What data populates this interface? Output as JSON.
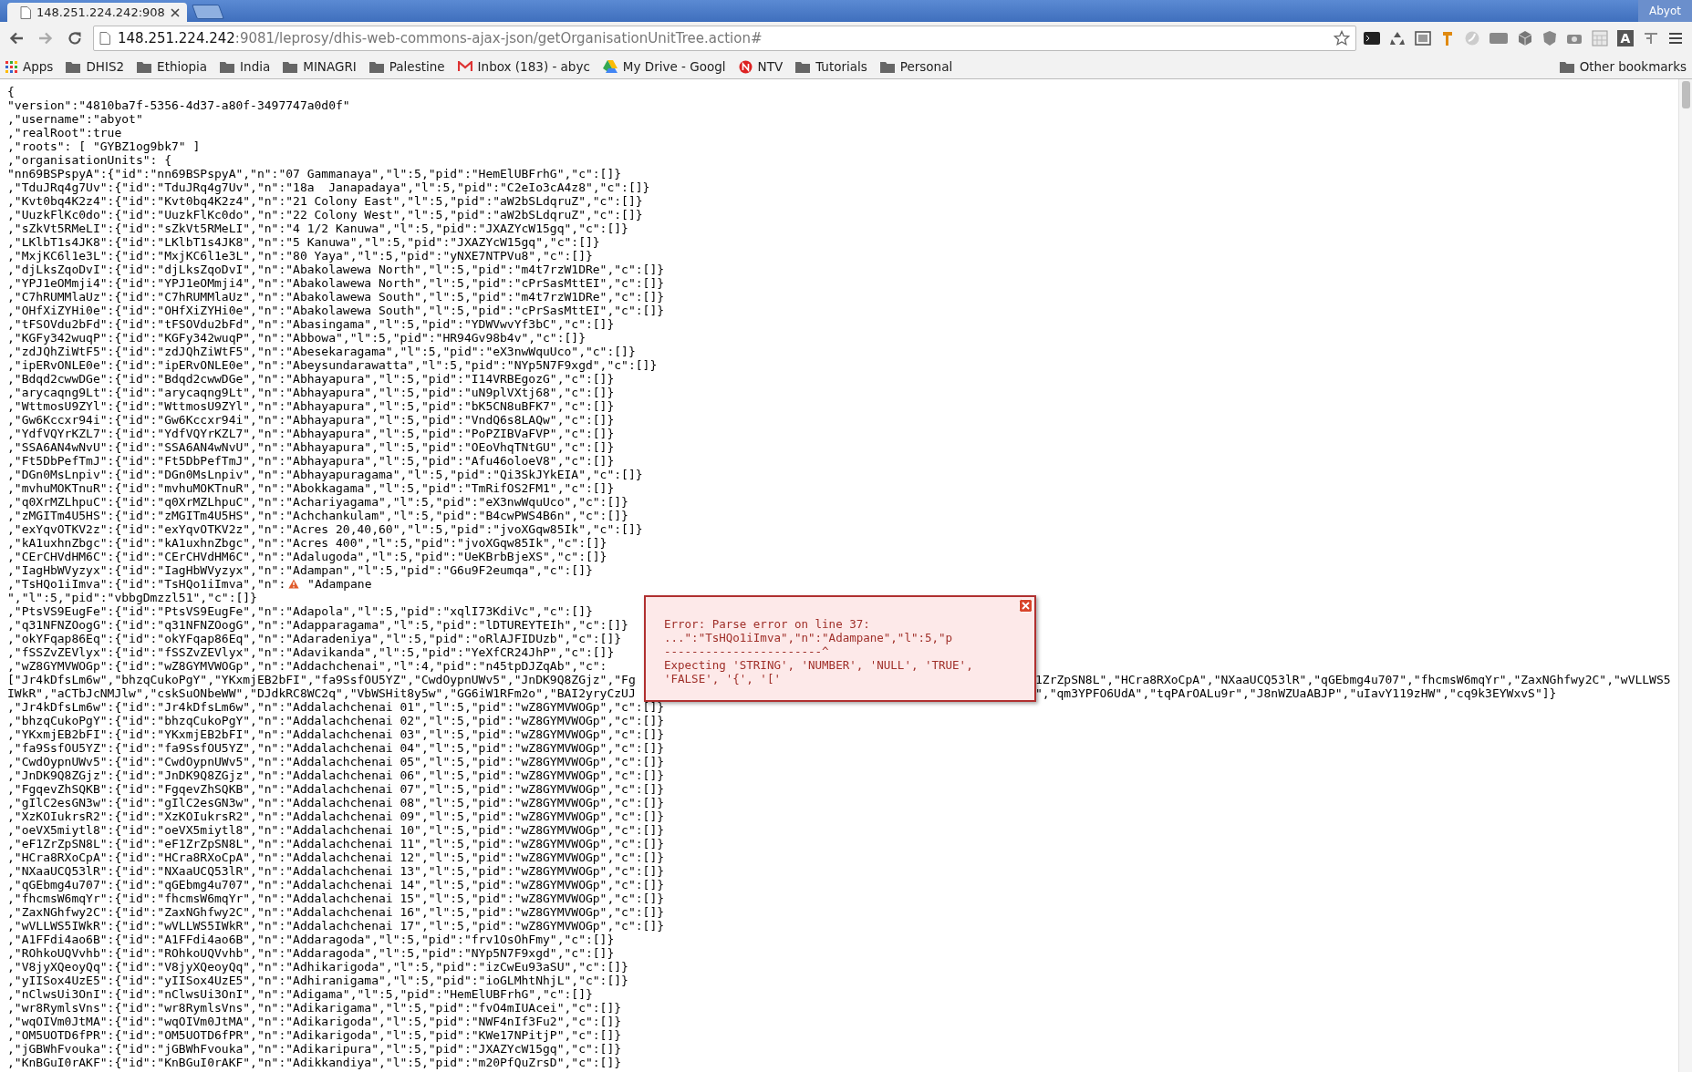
{
  "tab": {
    "title": "148.251.224.242:908",
    "selected": true
  },
  "user": "Abyot",
  "address": {
    "host": "148.251.224.242",
    "path": ":9081/leprosy/dhis-web-commons-ajax-json/getOrganisationUnitTree.action#"
  },
  "extension_label": "A",
  "bookmarks": [
    {
      "kind": "apps",
      "label": "Apps"
    },
    {
      "kind": "folder",
      "label": "DHIS2"
    },
    {
      "kind": "folder",
      "label": "Ethiopia"
    },
    {
      "kind": "folder",
      "label": "India"
    },
    {
      "kind": "folder",
      "label": "MINAGRI"
    },
    {
      "kind": "folder",
      "label": "Palestine"
    },
    {
      "kind": "mail",
      "label": "Inbox (183) - abyc"
    },
    {
      "kind": "drive",
      "label": "My Drive - Googl"
    },
    {
      "kind": "news",
      "label": "NTV"
    },
    {
      "kind": "folder",
      "label": "Tutorials"
    },
    {
      "kind": "folder",
      "label": "Personal"
    }
  ],
  "other_bookmarks": "Other bookmarks",
  "lines": [
    {
      "kind": "plain",
      "text": "{"
    },
    {
      "kind": "plain",
      "text": "\"version\":\"4810ba7f-5356-4d37-a80f-3497747a0d0f\""
    },
    {
      "kind": "plain",
      "text": ",\"username\":\"abyot\""
    },
    {
      "kind": "plain",
      "text": ",\"realRoot\":true"
    },
    {
      "kind": "plain",
      "text": ",\"roots\": [ \"GYBZ1og9bk7\" ]"
    },
    {
      "kind": "plain",
      "text": ",\"organisationUnits\": {"
    },
    {
      "kind": "plain",
      "text": "\"nn69BSPspyA\":{\"id\":\"nn69BSPspyA\",\"n\":\"07 Gammanaya\",\"l\":5,\"pid\":\"HemElUBFrhG\",\"c\":[]}"
    },
    {
      "kind": "plain",
      "text": ",\"TduJRq4g7Uv\":{\"id\":\"TduJRq4g7Uv\",\"n\":\"18a  Janapadaya\",\"l\":5,\"pid\":\"C2eIo3cA4z8\",\"c\":[]}"
    },
    {
      "kind": "plain",
      "text": ",\"Kvt0bq4K2z4\":{\"id\":\"Kvt0bq4K2z4\",\"n\":\"21 Colony East\",\"l\":5,\"pid\":\"aW2bSLdqruZ\",\"c\":[]}"
    },
    {
      "kind": "plain",
      "text": ",\"UuzkFlKc0do\":{\"id\":\"UuzkFlKc0do\",\"n\":\"22 Colony West\",\"l\":5,\"pid\":\"aW2bSLdqruZ\",\"c\":[]}"
    },
    {
      "kind": "plain",
      "text": ",\"sZkVt5RMeLI\":{\"id\":\"sZkVt5RMeLI\",\"n\":\"4 1/2 Kanuwa\",\"l\":5,\"pid\":\"JXAZYcW15gq\",\"c\":[]}"
    },
    {
      "kind": "plain",
      "text": ",\"LKlbT1s4JK8\":{\"id\":\"LKlbT1s4JK8\",\"n\":\"5 Kanuwa\",\"l\":5,\"pid\":\"JXAZYcW15gq\",\"c\":[]}"
    },
    {
      "kind": "plain",
      "text": ",\"MxjKC6l1e3L\":{\"id\":\"MxjKC6l1e3L\",\"n\":\"80 Yaya\",\"l\":5,\"pid\":\"yNXE7NTPVu8\",\"c\":[]}"
    },
    {
      "kind": "plain",
      "text": ",\"djLksZqoDvI\":{\"id\":\"djLksZqoDvI\",\"n\":\"Abakolawewa North\",\"l\":5,\"pid\":\"m4t7rzW1DRe\",\"c\":[]}"
    },
    {
      "kind": "plain",
      "text": ",\"YPJ1eOMmji4\":{\"id\":\"YPJ1eOMmji4\",\"n\":\"Abakolawewa North\",\"l\":5,\"pid\":\"cPrSasMttEI\",\"c\":[]}"
    },
    {
      "kind": "plain",
      "text": ",\"C7hRUMMlaUz\":{\"id\":\"C7hRUMMlaUz\",\"n\":\"Abakolawewa South\",\"l\":5,\"pid\":\"m4t7rzW1DRe\",\"c\":[]}"
    },
    {
      "kind": "plain",
      "text": ",\"OHfXiZYHi0e\":{\"id\":\"OHfXiZYHi0e\",\"n\":\"Abakolawewa South\",\"l\":5,\"pid\":\"cPrSasMttEI\",\"c\":[]}"
    },
    {
      "kind": "plain",
      "text": ",\"tFSOVdu2bFd\":{\"id\":\"tFSOVdu2bFd\",\"n\":\"Abasingama\",\"l\":5,\"pid\":\"YDWVwvYf3bC\",\"c\":[]}"
    },
    {
      "kind": "plain",
      "text": ",\"KGFy342wuqP\":{\"id\":\"KGFy342wuqP\",\"n\":\"Abbowa\",\"l\":5,\"pid\":\"HR94Gv98b4v\",\"c\":[]}"
    },
    {
      "kind": "plain",
      "text": ",\"zdJQhZiWtF5\":{\"id\":\"zdJQhZiWtF5\",\"n\":\"Abesekaragama\",\"l\":5,\"pid\":\"eX3nwWquUco\",\"c\":[]}"
    },
    {
      "kind": "plain",
      "text": ",\"ipERvONLE0e\":{\"id\":\"ipERvONLE0e\",\"n\":\"Abeysundarawatta\",\"l\":5,\"pid\":\"NYp5N7F9xgd\",\"c\":[]}"
    },
    {
      "kind": "plain",
      "text": ",\"Bdqd2cwwDGe\":{\"id\":\"Bdqd2cwwDGe\",\"n\":\"Abhayapura\",\"l\":5,\"pid\":\"I14VRBEgozG\",\"c\":[]}"
    },
    {
      "kind": "plain",
      "text": ",\"arycaqng9Lt\":{\"id\":\"arycaqng9Lt\",\"n\":\"Abhayapura\",\"l\":5,\"pid\":\"uN9plVXtj68\",\"c\":[]}"
    },
    {
      "kind": "plain",
      "text": ",\"WttmosU9ZYl\":{\"id\":\"WttmosU9ZYl\",\"n\":\"Abhayapura\",\"l\":5,\"pid\":\"bK5CN8uBFK7\",\"c\":[]}"
    },
    {
      "kind": "plain",
      "text": ",\"Gw6Kccxr94i\":{\"id\":\"Gw6Kccxr94i\",\"n\":\"Abhayapura\",\"l\":5,\"pid\":\"VndQ6s8LAQw\",\"c\":[]}"
    },
    {
      "kind": "plain",
      "text": ",\"YdfVQYrKZL7\":{\"id\":\"YdfVQYrKZL7\",\"n\":\"Abhayapura\",\"l\":5,\"pid\":\"PoPZIBVaFVP\",\"c\":[]}"
    },
    {
      "kind": "plain",
      "text": ",\"SSA6AN4wNvU\":{\"id\":\"SSA6AN4wNvU\",\"n\":\"Abhayapura\",\"l\":5,\"pid\":\"OEoVhqTNtGU\",\"c\":[]}"
    },
    {
      "kind": "plain",
      "text": ",\"Ft5DbPefTmJ\":{\"id\":\"Ft5DbPefTmJ\",\"n\":\"Abhayapura\",\"l\":5,\"pid\":\"Afu46oloeV8\",\"c\":[]}"
    },
    {
      "kind": "plain",
      "text": ",\"DGn0MsLnpiv\":{\"id\":\"DGn0MsLnpiv\",\"n\":\"Abhayapuragama\",\"l\":5,\"pid\":\"Qi3SkJYkEIA\",\"c\":[]}"
    },
    {
      "kind": "plain",
      "text": ",\"mvhuMOKTnuR\":{\"id\":\"mvhuMOKTnuR\",\"n\":\"Abokkagama\",\"l\":5,\"pid\":\"TmRifOS2FM1\",\"c\":[]}"
    },
    {
      "kind": "plain",
      "text": ",\"q0XrMZLhpuC\":{\"id\":\"q0XrMZLhpuC\",\"n\":\"Achariyagama\",\"l\":5,\"pid\":\"eX3nwWquUco\",\"c\":[]}"
    },
    {
      "kind": "plain",
      "text": ",\"zMGITm4U5HS\":{\"id\":\"zMGITm4U5HS\",\"n\":\"Achchankulam\",\"l\":5,\"pid\":\"B4cwPWS4B6n\",\"c\":[]}"
    },
    {
      "kind": "plain",
      "text": ",\"exYqvOTKV2z\":{\"id\":\"exYqvOTKV2z\",\"n\":\"Acres 20,40,60\",\"l\":5,\"pid\":\"jvoXGqw85Ik\",\"c\":[]}"
    },
    {
      "kind": "plain",
      "text": ",\"kA1uxhnZbgc\":{\"id\":\"kA1uxhnZbgc\",\"n\":\"Acres 400\",\"l\":5,\"pid\":\"jvoXGqw85Ik\",\"c\":[]}"
    },
    {
      "kind": "plain",
      "text": ",\"CErCHVdHM6C\":{\"id\":\"CErCHVdHM6C\",\"n\":\"Adalugoda\",\"l\":5,\"pid\":\"UeKBrbBjeXS\",\"c\":[]}"
    },
    {
      "kind": "plain",
      "text": ",\"IagHbWVyzyx\":{\"id\":\"IagHbWVyzyx\",\"n\":\"Adampan\",\"l\":5,\"pid\":\"G6u9F2eumqa\",\"c\":[]}"
    },
    {
      "kind": "warning",
      "before": ",\"TsHQo1iImva\":{\"id\":\"TsHQo1iImva\",\"n\":",
      "after": " \"Adampane"
    },
    {
      "kind": "plain",
      "text": "\",\"l\":5,\"pid\":\"vbbgDmzzl51\",\"c\":[]}"
    },
    {
      "kind": "plain",
      "text": ",\"PtsVS9EugFe\":{\"id\":\"PtsVS9EugFe\",\"n\":\"Adapola\",\"l\":5,\"pid\":\"xqlI73KdiVc\",\"c\":[]}"
    },
    {
      "kind": "plain",
      "text": ",\"q31NFNZOogG\":{\"id\":\"q31NFNZOogG\",\"n\":\"Adapparagama\",\"l\":5,\"pid\":\"lDTUREYTEIh\",\"c\":[]}"
    },
    {
      "kind": "plain",
      "text": ",\"okYFqap86Eq\":{\"id\":\"okYFqap86Eq\",\"n\":\"Adaradeniya\",\"l\":5,\"pid\":\"oRlAJFIDUzb\",\"c\":[]}"
    },
    {
      "kind": "plain",
      "text": ",\"fSSZvZEVlyx\":{\"id\":\"fSSZvZEVlyx\",\"n\":\"Adavikanda\",\"l\":5,\"pid\":\"YeXfCR24JhP\",\"c\":[]}"
    },
    {
      "kind": "plain",
      "text": ",\"wZ8GYMVWOGp\":{\"id\":\"wZ8GYMVWOGp\",\"n\":\"Addachchenai\",\"l\":4,\"pid\":\"n45tpDJZqAb\",\"c\":"
    },
    {
      "kind": "split",
      "left": "[\"Jr4kDfsLm6w\",\"bhzqCukoPgY\",\"YKxmjEB2bFI\",\"fa9SsfOU5YZ\",\"CwdOypnUWv5\",\"JnDK9Q8ZGjz\",\"Fg",
      "right": "1ZrZpSN8L\",\"HCra8RXoCpA\",\"NXaaUCQ53lR\",\"qGEbmg4u707\",\"fhcmsW6mqYr\",\"ZaxNGhfwy2C\",\"wVLLWS5"
    },
    {
      "kind": "split",
      "left": "IWkR\",\"aCTbJcNMJlw\",\"cskSuONbeWW\",\"DJdkRC8WC2q\",\"VbWSHit8y5w\",\"GG6iW1RFm2o\",\"BAI2yryCzUJ",
      "right": "\",\"qm3YPFO6UdA\",\"tqPArOALu9r\",\"J8nWZUaABJP\",\"uIavY119zHW\",\"cq9k3EYWxvS\"]}"
    },
    {
      "kind": "plain",
      "text": ",\"Jr4kDfsLm6w\":{\"id\":\"Jr4kDfsLm6w\",\"n\":\"Addalachchenai 01\",\"l\":5,\"pid\":\"wZ8GYMVWOGp\",\"c\":[]}"
    },
    {
      "kind": "plain",
      "text": ",\"bhzqCukoPgY\":{\"id\":\"bhzqCukoPgY\",\"n\":\"Addalachchenai 02\",\"l\":5,\"pid\":\"wZ8GYMVWOGp\",\"c\":[]}"
    },
    {
      "kind": "plain",
      "text": ",\"YKxmjEB2bFI\":{\"id\":\"YKxmjEB2bFI\",\"n\":\"Addalachchenai 03\",\"l\":5,\"pid\":\"wZ8GYMVWOGp\",\"c\":[]}"
    },
    {
      "kind": "plain",
      "text": ",\"fa9SsfOU5YZ\":{\"id\":\"fa9SsfOU5YZ\",\"n\":\"Addalachchenai 04\",\"l\":5,\"pid\":\"wZ8GYMVWOGp\",\"c\":[]}"
    },
    {
      "kind": "plain",
      "text": ",\"CwdOypnUWv5\":{\"id\":\"CwdOypnUWv5\",\"n\":\"Addalachchenai 05\",\"l\":5,\"pid\":\"wZ8GYMVWOGp\",\"c\":[]}"
    },
    {
      "kind": "plain",
      "text": ",\"JnDK9Q8ZGjz\":{\"id\":\"JnDK9Q8ZGjz\",\"n\":\"Addalachchenai 06\",\"l\":5,\"pid\":\"wZ8GYMVWOGp\",\"c\":[]}"
    },
    {
      "kind": "plain",
      "text": ",\"FgqevZhSQKB\":{\"id\":\"FgqevZhSQKB\",\"n\":\"Addalachchenai 07\",\"l\":5,\"pid\":\"wZ8GYMVWOGp\",\"c\":[]}"
    },
    {
      "kind": "plain",
      "text": ",\"gIlC2esGN3w\":{\"id\":\"gIlC2esGN3w\",\"n\":\"Addalachchenai 08\",\"l\":5,\"pid\":\"wZ8GYMVWOGp\",\"c\":[]}"
    },
    {
      "kind": "plain",
      "text": ",\"XzKOIukrsR2\":{\"id\":\"XzKOIukrsR2\",\"n\":\"Addalachchenai 09\",\"l\":5,\"pid\":\"wZ8GYMVWOGp\",\"c\":[]}"
    },
    {
      "kind": "plain",
      "text": ",\"oeVX5miytl8\":{\"id\":\"oeVX5miytl8\",\"n\":\"Addalachchenai 10\",\"l\":5,\"pid\":\"wZ8GYMVWOGp\",\"c\":[]}"
    },
    {
      "kind": "plain",
      "text": ",\"eF1ZrZpSN8L\":{\"id\":\"eF1ZrZpSN8L\",\"n\":\"Addalachchenai 11\",\"l\":5,\"pid\":\"wZ8GYMVWOGp\",\"c\":[]}"
    },
    {
      "kind": "plain",
      "text": ",\"HCra8RXoCpA\":{\"id\":\"HCra8RXoCpA\",\"n\":\"Addalachchenai 12\",\"l\":5,\"pid\":\"wZ8GYMVWOGp\",\"c\":[]}"
    },
    {
      "kind": "plain",
      "text": ",\"NXaaUCQ53lR\":{\"id\":\"NXaaUCQ53lR\",\"n\":\"Addalachchenai 13\",\"l\":5,\"pid\":\"wZ8GYMVWOGp\",\"c\":[]}"
    },
    {
      "kind": "plain",
      "text": ",\"qGEbmg4u707\":{\"id\":\"qGEbmg4u707\",\"n\":\"Addalachchenai 14\",\"l\":5,\"pid\":\"wZ8GYMVWOGp\",\"c\":[]}"
    },
    {
      "kind": "plain",
      "text": ",\"fhcmsW6mqYr\":{\"id\":\"fhcmsW6mqYr\",\"n\":\"Addalachchenai 15\",\"l\":5,\"pid\":\"wZ8GYMVWOGp\",\"c\":[]}"
    },
    {
      "kind": "plain",
      "text": ",\"ZaxNGhfwy2C\":{\"id\":\"ZaxNGhfwy2C\",\"n\":\"Addalachchenai 16\",\"l\":5,\"pid\":\"wZ8GYMVWOGp\",\"c\":[]}"
    },
    {
      "kind": "plain",
      "text": ",\"wVLLWS5IWkR\":{\"id\":\"wVLLWS5IWkR\",\"n\":\"Addalachchenai 17\",\"l\":5,\"pid\":\"wZ8GYMVWOGp\",\"c\":[]}"
    },
    {
      "kind": "plain",
      "text": ",\"A1FFdi4ao6B\":{\"id\":\"A1FFdi4ao6B\",\"n\":\"Addaragoda\",\"l\":5,\"pid\":\"frv1OsOhFmy\",\"c\":[]}"
    },
    {
      "kind": "plain",
      "text": ",\"ROhkoUQVvhb\":{\"id\":\"ROhkoUQVvhb\",\"n\":\"Addaragoda\",\"l\":5,\"pid\":\"NYp5N7F9xgd\",\"c\":[]}"
    },
    {
      "kind": "plain",
      "text": ",\"V8jyXQeoyQq\":{\"id\":\"V8jyXQeoyQq\",\"n\":\"Adhikarigoda\",\"l\":5,\"pid\":\"izCwEu93aSU\",\"c\":[]}"
    },
    {
      "kind": "plain",
      "text": ",\"yIISox4UzE5\":{\"id\":\"yIISox4UzE5\",\"n\":\"Adhiranigama\",\"l\":5,\"pid\":\"ioGLMhtNhjL\",\"c\":[]}"
    },
    {
      "kind": "plain",
      "text": ",\"nClwsUi3OnI\":{\"id\":\"nClwsUi3OnI\",\"n\":\"Adigama\",\"l\":5,\"pid\":\"HemElUBFrhG\",\"c\":[]}"
    },
    {
      "kind": "plain",
      "text": ",\"wr8RymlsVns\":{\"id\":\"wr8RymlsVns\",\"n\":\"Adikarigama\",\"l\":5,\"pid\":\"fvO4mIUAcei\",\"c\":[]}"
    },
    {
      "kind": "plain",
      "text": ",\"wqOIVm0JtMA\":{\"id\":\"wqOIVm0JtMA\",\"n\":\"Adikarigoda\",\"l\":5,\"pid\":\"NWF4nIf3Fu2\",\"c\":[]}"
    },
    {
      "kind": "plain",
      "text": ",\"OM5UOTD6fPR\":{\"id\":\"OM5UOTD6fPR\",\"n\":\"Adikarigoda\",\"l\":5,\"pid\":\"KWe17NPitjP\",\"c\":[]}"
    },
    {
      "kind": "plain",
      "text": ",\"jGBWhFvouka\":{\"id\":\"jGBWhFvouka\",\"n\":\"Adikaripura\",\"l\":5,\"pid\":\"JXAZYcW15gq\",\"c\":[]}"
    },
    {
      "kind": "plain",
      "text": ",\"KnBGuI0rAKF\":{\"id\":\"KnBGuI0rAKF\",\"n\":\"Adikkandiya\",\"l\":5,\"pid\":\"m20PfQuZrsD\",\"c\":[]}"
    }
  ],
  "error": {
    "lines": [
      "Error: Parse error on line 37:",
      "...\":\"TsHQo1iImva\",\"n\":\"Adampane\",\"l\":5,\"p",
      "-----------------------^",
      "Expecting 'STRING', 'NUMBER', 'NULL', 'TRUE',",
      "'FALSE', '{', '['"
    ]
  }
}
